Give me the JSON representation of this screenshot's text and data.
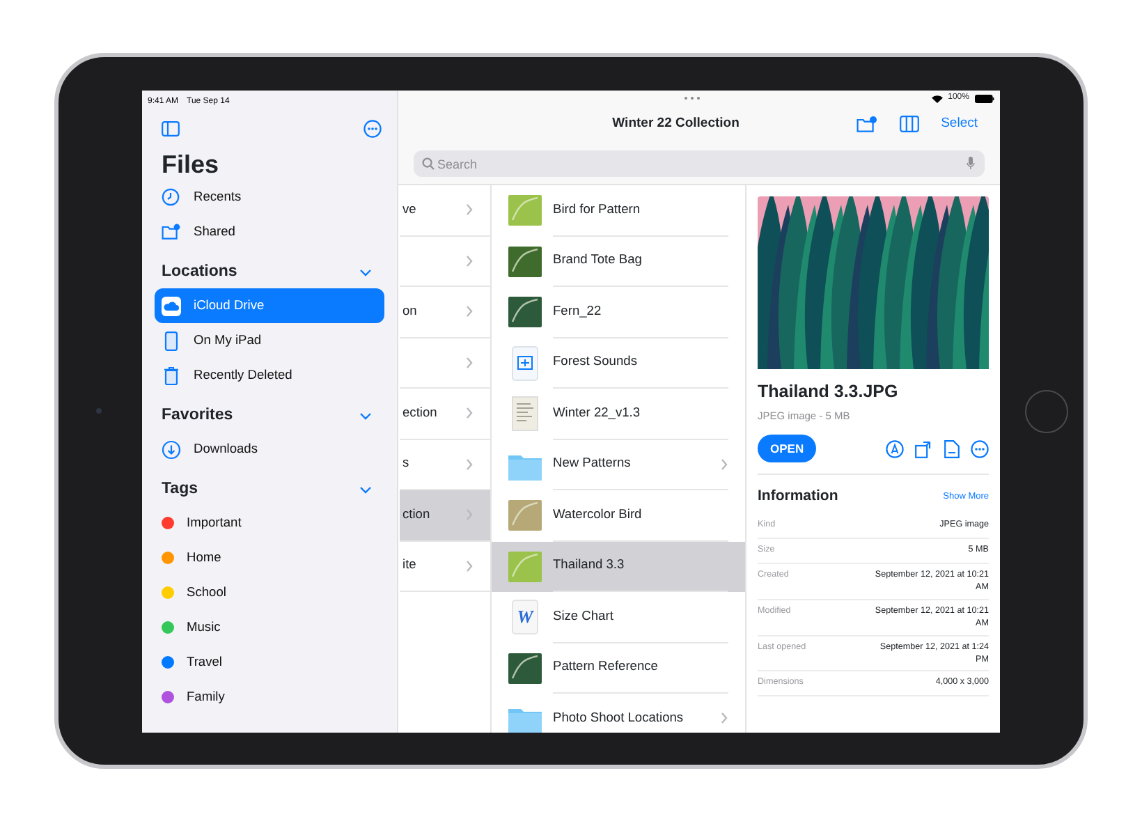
{
  "status_bar": {
    "time": "9:41 AM",
    "date": "Tue Sep 14",
    "battery": "100%"
  },
  "sidebar": {
    "title": "Files",
    "top_items": [
      {
        "label": "Recents",
        "selected": false
      },
      {
        "label": "Shared",
        "selected": false
      }
    ],
    "sections": [
      {
        "title": "Locations",
        "expanded": true,
        "items": [
          {
            "label": "iCloud Drive",
            "selected": true
          },
          {
            "label": "On My iPad",
            "selected": false
          },
          {
            "label": "Recently Deleted",
            "selected": false
          }
        ]
      },
      {
        "title": "Favorites",
        "expanded": true,
        "items": [
          {
            "label": "Downloads",
            "selected": false
          }
        ]
      },
      {
        "title": "Tags",
        "expanded": true,
        "items": [
          {
            "label": "Important",
            "color": "#ff3b30",
            "selected": false
          },
          {
            "label": "Home",
            "color": "#ff9500",
            "selected": false
          },
          {
            "label": "School",
            "color": "#ffcc00",
            "selected": false
          },
          {
            "label": "Music",
            "color": "#34c759",
            "selected": false
          },
          {
            "label": "Travel",
            "color": "#007aff",
            "selected": false
          },
          {
            "label": "Family",
            "color": "#af52de",
            "selected": false
          }
        ]
      }
    ]
  },
  "toolbar": {
    "title": "Winter 22 Collection",
    "select": "Select"
  },
  "search": {
    "placeholder": "Search"
  },
  "column_1": [
    {
      "label": "ve",
      "selected": false
    },
    {
      "selected": false
    },
    {
      "label": "on",
      "selected": false
    },
    {
      "selected": false
    },
    {
      "label": "ection",
      "selected": false
    },
    {
      "label": "s",
      "selected": false
    },
    {
      "label": "ction",
      "selected": true
    },
    {
      "label": "ite",
      "selected": false
    }
  ],
  "files": [
    {
      "name": "Bird for Pattern",
      "kind": "image",
      "selected": false
    },
    {
      "name": "Brand Tote Bag",
      "kind": "image",
      "selected": false
    },
    {
      "name": "Fern_22",
      "kind": "image",
      "selected": false
    },
    {
      "name": "Forest Sounds",
      "kind": "audio",
      "selected": false
    },
    {
      "name": "Winter 22_v1.3",
      "kind": "document",
      "selected": false
    },
    {
      "name": "New Patterns",
      "kind": "folder",
      "selected": false
    },
    {
      "name": "Watercolor Bird",
      "kind": "image",
      "selected": false
    },
    {
      "name": "Thailand 3.3",
      "kind": "image",
      "selected": true
    },
    {
      "name": "Size Chart",
      "kind": "word",
      "glyph": "W",
      "selected": false
    },
    {
      "name": "Pattern Reference",
      "kind": "image",
      "selected": false
    },
    {
      "name": "Photo Shoot Locations",
      "kind": "folder",
      "selected": false
    }
  ],
  "preview": {
    "title": "Thailand 3.3.JPG",
    "subtitle": "JPEG image - 5 MB",
    "open_button": "OPEN",
    "information": {
      "title": "Information",
      "link": "Show More",
      "rows": [
        {
          "label": "Kind",
          "value": "JPEG image"
        },
        {
          "label": "Size",
          "value": "5 MB"
        },
        {
          "label": "Created",
          "value": "September 12, 2021 at 10:21 AM"
        },
        {
          "label": "Modified",
          "value": "September 12, 2021 at 10:21 AM"
        },
        {
          "label": "Last opened",
          "value": "September 12, 2021 at 1:24 PM"
        },
        {
          "label": "Dimensions",
          "value": "4,000 x 3,000"
        }
      ]
    }
  }
}
